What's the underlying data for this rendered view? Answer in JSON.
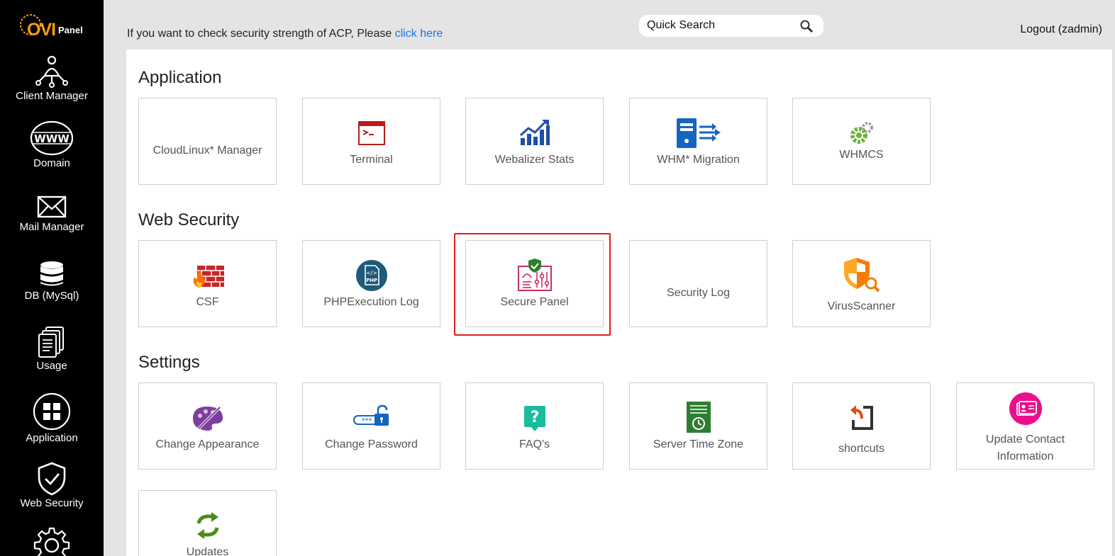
{
  "brand": {
    "name_part1": "OVI",
    "name_part2": "Panel"
  },
  "sidebar": {
    "items": [
      {
        "label": "Client Manager",
        "icon": "client-manager-icon"
      },
      {
        "label": "Domain",
        "icon": "www-globe-icon"
      },
      {
        "label": "Mail Manager",
        "icon": "envelope-icon"
      },
      {
        "label": "DB (MySql)",
        "icon": "database-icon"
      },
      {
        "label": "Usage",
        "icon": "documents-icon"
      },
      {
        "label": "Application",
        "icon": "grid-icon"
      },
      {
        "label": "Web Security",
        "icon": "shield-check-icon"
      },
      {
        "label": "",
        "icon": "gear-icon"
      }
    ]
  },
  "topbar": {
    "security_text": "If you want to check security strength of ACP, Please",
    "security_link": "click here",
    "search_placeholder": "Quick Search",
    "logout": "Logout (zadmin)"
  },
  "sections": {
    "application": {
      "title": "Application",
      "tiles": [
        "CloudLinux* Manager",
        "Terminal",
        "Webalizer Stats",
        "WHM* Migration",
        "WHMCS"
      ]
    },
    "web_security": {
      "title": "Web Security",
      "tiles": [
        "CSF",
        "PHPExecution Log",
        "Secure Panel",
        "Security Log",
        "VirusScanner"
      ]
    },
    "settings": {
      "title": "Settings",
      "tiles": [
        "Change Appearance",
        "Change Password",
        "FAQ's",
        "Server Time Zone",
        "shortcuts",
        "Update Contact Information",
        "Updates"
      ]
    }
  },
  "colors": {
    "sidebar_bg": "#000000",
    "brand_orange": "#f59a12",
    "link_blue": "#1a73e8",
    "highlight_red": "#e01e1e"
  }
}
